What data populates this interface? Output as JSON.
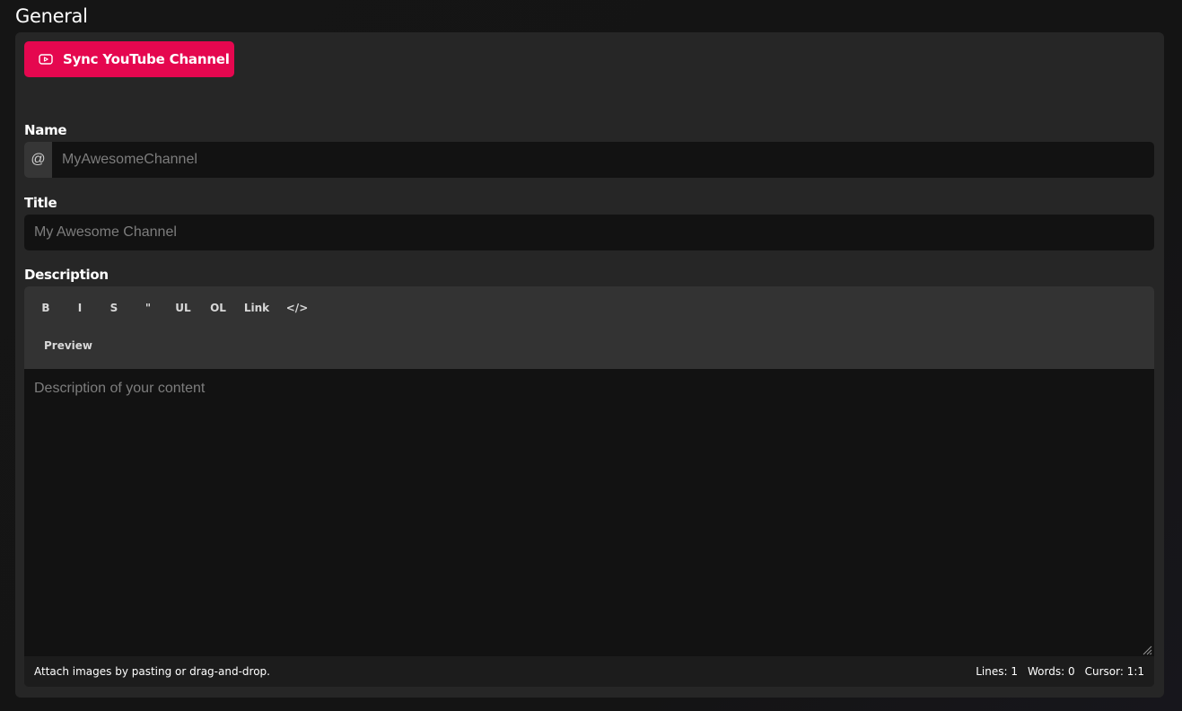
{
  "section": {
    "title": "General"
  },
  "sync_button": {
    "label": "Sync YouTube Channel",
    "icon": "youtube-icon",
    "color": "#e5074f"
  },
  "fields": {
    "name": {
      "label": "Name",
      "prefix": "@",
      "placeholder": "MyAwesomeChannel",
      "value": ""
    },
    "title": {
      "label": "Title",
      "placeholder": "My Awesome Channel",
      "value": ""
    },
    "description": {
      "label": "Description",
      "placeholder": "Description of your content",
      "value": ""
    }
  },
  "editor": {
    "toolbar": [
      {
        "id": "bold",
        "label": "B"
      },
      {
        "id": "italic",
        "label": "I"
      },
      {
        "id": "strikethrough",
        "label": "S"
      },
      {
        "id": "quote",
        "label": "\""
      },
      {
        "id": "unordered-list",
        "label": "UL"
      },
      {
        "id": "ordered-list",
        "label": "OL"
      },
      {
        "id": "link",
        "label": "Link"
      },
      {
        "id": "code",
        "label": "</>"
      }
    ],
    "preview_label": "Preview",
    "status": {
      "hint": "Attach images by pasting or drag-and-drop.",
      "lines": "Lines: 1",
      "words": "Words: 0",
      "cursor": "Cursor: 1:1"
    }
  },
  "colors": {
    "page_bg": "#141414",
    "panel_bg": "#262626",
    "input_bg": "#121212",
    "accent": "#e5074f"
  }
}
